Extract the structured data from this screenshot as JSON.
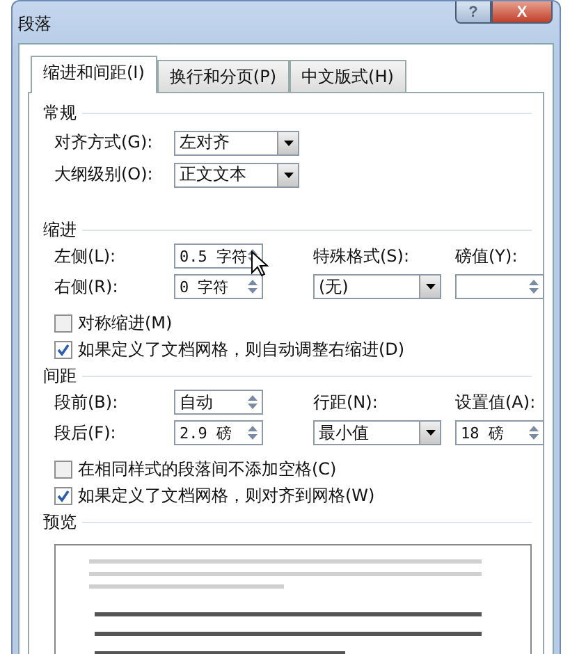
{
  "window": {
    "title": "段落",
    "help_button": "?",
    "close_button": "X"
  },
  "tabs": [
    {
      "label": "缩进和间距(I)",
      "selected": true
    },
    {
      "label": "换行和分页(P)",
      "selected": false
    },
    {
      "label": "中文版式(H)",
      "selected": false
    }
  ],
  "general": {
    "heading": "常规",
    "alignment": {
      "label": "对齐方式(G):",
      "value": "左对齐"
    },
    "outline_level": {
      "label": "大纲级别(O):",
      "value": "正文文本"
    }
  },
  "indent": {
    "heading": "缩进",
    "left": {
      "label": "左侧(L):",
      "value": "0.5 字符"
    },
    "right": {
      "label": "右侧(R):",
      "value": "0 字符"
    },
    "special": {
      "label": "特殊格式(S):",
      "value": "(无)"
    },
    "by": {
      "label": "磅值(Y):"
    },
    "checkboxes": [
      {
        "label": "对称缩进(M)",
        "checked": false
      },
      {
        "label": "如果定义了文档网格，则自动调整右缩进(D)",
        "checked": true
      }
    ]
  },
  "spacing": {
    "heading": "间距",
    "before": {
      "label": "段前(B):",
      "value": "自动"
    },
    "after": {
      "label": "段后(F):",
      "value": "2.9 磅"
    },
    "line_spacing": {
      "label": "行距(N):",
      "value": "最小值"
    },
    "at": {
      "label": "设置值(A):",
      "value": "18 磅"
    },
    "checkboxes": [
      {
        "label": "在相同样式的段落间不添加空格(C)",
        "checked": false
      },
      {
        "label": "如果定义了文档网格，则对齐到网格(W)",
        "checked": true
      }
    ]
  },
  "preview": {
    "heading": "预览"
  }
}
